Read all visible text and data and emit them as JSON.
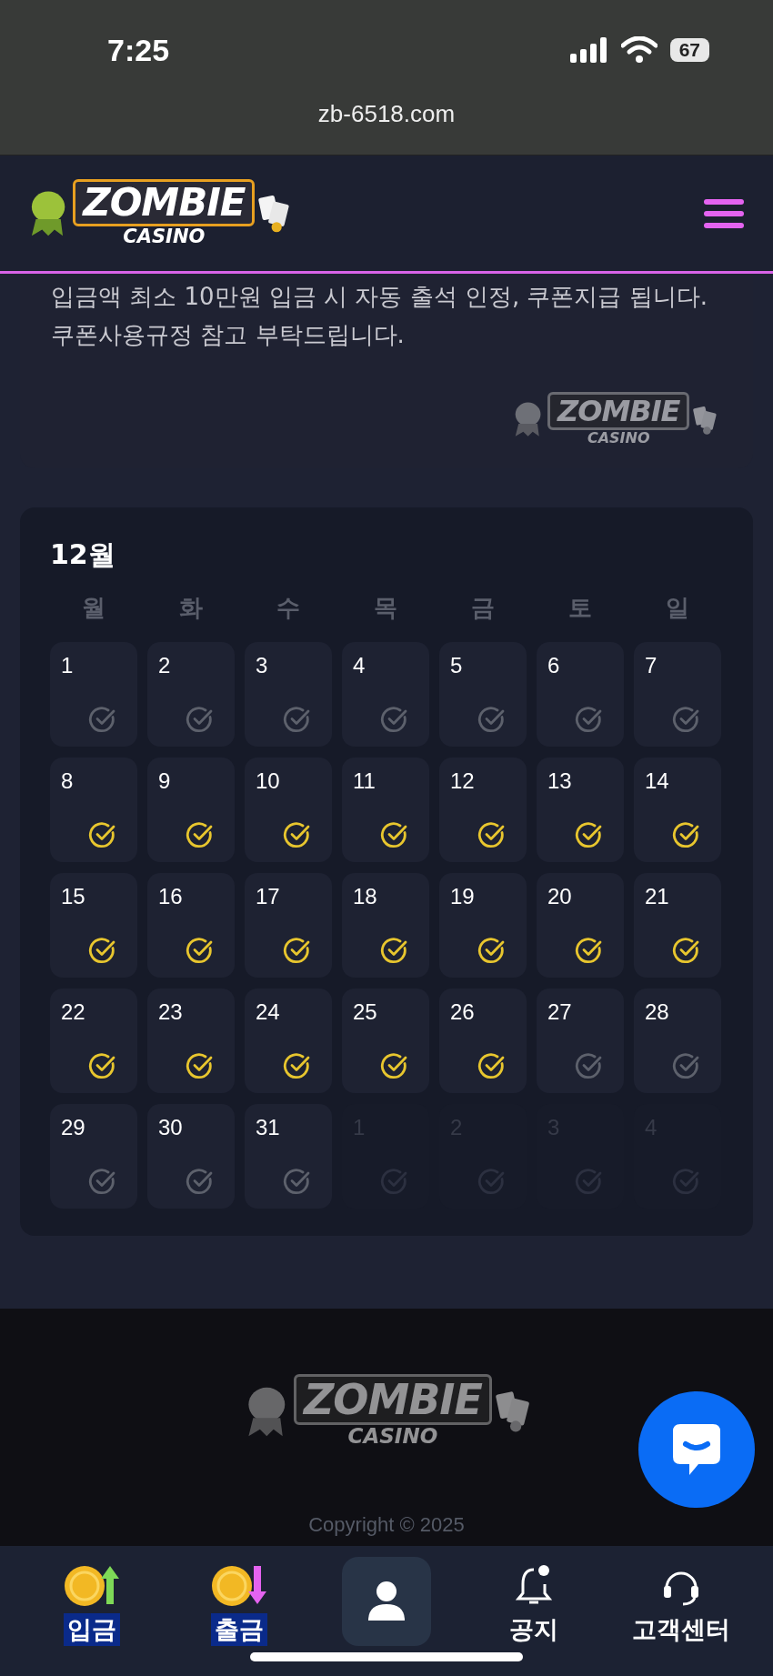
{
  "status_bar": {
    "time": "7:25",
    "battery": "67"
  },
  "browser": {
    "url": "zb-6518.com"
  },
  "header": {
    "logo": {
      "title": "ZOMBIE",
      "subtitle": "CASINO"
    }
  },
  "notice": {
    "paragraphs": [
      "입금액 최소 10만원 입금 시 자동 출석 인정, 쿠폰지급 됩니다.",
      "쿠폰사용규정 참고 부탁드립니다."
    ],
    "logo": {
      "title": "ZOMBIE",
      "subtitle": "CASINO"
    }
  },
  "calendar": {
    "title": "12월",
    "weekdays": [
      "월",
      "화",
      "수",
      "목",
      "금",
      "토",
      "일"
    ],
    "days": [
      {
        "label": "1",
        "checked": false,
        "outside": false
      },
      {
        "label": "2",
        "checked": false,
        "outside": false
      },
      {
        "label": "3",
        "checked": false,
        "outside": false
      },
      {
        "label": "4",
        "checked": false,
        "outside": false
      },
      {
        "label": "5",
        "checked": false,
        "outside": false
      },
      {
        "label": "6",
        "checked": false,
        "outside": false
      },
      {
        "label": "7",
        "checked": false,
        "outside": false
      },
      {
        "label": "8",
        "checked": true,
        "outside": false
      },
      {
        "label": "9",
        "checked": true,
        "outside": false
      },
      {
        "label": "10",
        "checked": true,
        "outside": false
      },
      {
        "label": "11",
        "checked": true,
        "outside": false
      },
      {
        "label": "12",
        "checked": true,
        "outside": false
      },
      {
        "label": "13",
        "checked": true,
        "outside": false
      },
      {
        "label": "14",
        "checked": true,
        "outside": false
      },
      {
        "label": "15",
        "checked": true,
        "outside": false
      },
      {
        "label": "16",
        "checked": true,
        "outside": false
      },
      {
        "label": "17",
        "checked": true,
        "outside": false
      },
      {
        "label": "18",
        "checked": true,
        "outside": false
      },
      {
        "label": "19",
        "checked": true,
        "outside": false
      },
      {
        "label": "20",
        "checked": true,
        "outside": false
      },
      {
        "label": "21",
        "checked": true,
        "outside": false
      },
      {
        "label": "22",
        "checked": true,
        "outside": false
      },
      {
        "label": "23",
        "checked": true,
        "outside": false
      },
      {
        "label": "24",
        "checked": true,
        "outside": false
      },
      {
        "label": "25",
        "checked": true,
        "outside": false
      },
      {
        "label": "26",
        "checked": true,
        "outside": false
      },
      {
        "label": "27",
        "checked": false,
        "outside": false
      },
      {
        "label": "28",
        "checked": false,
        "outside": false
      },
      {
        "label": "29",
        "checked": false,
        "outside": false
      },
      {
        "label": "30",
        "checked": false,
        "outside": false
      },
      {
        "label": "31",
        "checked": false,
        "outside": false
      },
      {
        "label": "1",
        "outside": true
      },
      {
        "label": "2",
        "outside": true
      },
      {
        "label": "3",
        "outside": true
      },
      {
        "label": "4",
        "outside": true
      }
    ]
  },
  "footer": {
    "logo": {
      "title": "ZOMBIE",
      "subtitle": "CASINO"
    },
    "copyright": "Copyright © 2025"
  },
  "bottom_nav": [
    {
      "kind": "deposit",
      "label": "입금",
      "highlighted": true
    },
    {
      "kind": "withdraw",
      "label": "출금",
      "highlighted": true
    },
    {
      "kind": "profile"
    },
    {
      "kind": "notice",
      "label": "공지",
      "highlighted": false
    },
    {
      "kind": "support",
      "label": "고객센터",
      "highlighted": false
    }
  ]
}
